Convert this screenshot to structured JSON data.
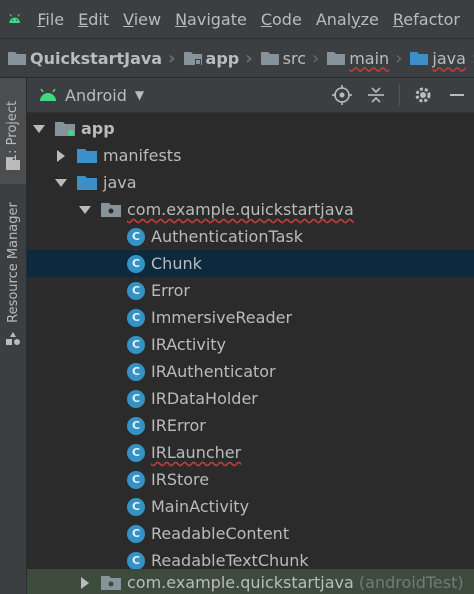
{
  "menubar": {
    "items": [
      {
        "label": "File",
        "underline": "F",
        "rest": "ile"
      },
      {
        "label": "Edit",
        "underline": "E",
        "rest": "dit"
      },
      {
        "label": "View",
        "underline": "V",
        "rest": "iew"
      },
      {
        "label": "Navigate",
        "underline": "N",
        "rest": "avigate"
      },
      {
        "label": "Code",
        "underline": "C",
        "rest": "ode"
      },
      {
        "label": "Analyze",
        "underline": "z",
        "rest": ""
      },
      {
        "label": "Refactor",
        "underline": "R",
        "rest": "efactor"
      }
    ]
  },
  "breadcrumb": {
    "project": "QuickstartJava",
    "module": "app",
    "src": "src",
    "main": "main",
    "java": "java"
  },
  "sidebar": {
    "project_tab": "1: Project",
    "resource_tab": "Resource Manager"
  },
  "toolbar": {
    "view_mode": "Android"
  },
  "tree": {
    "app": "app",
    "manifests": "manifests",
    "java": "java",
    "package": "com.example.quickstartjava",
    "classes": [
      "AuthenticationTask",
      "Chunk",
      "Error",
      "ImmersiveReader",
      "IRActivity",
      "IRAuthenticator",
      "IRDataHolder",
      "IRError",
      "IRLauncher",
      "IRStore",
      "MainActivity",
      "ReadableContent",
      "ReadableTextChunk"
    ],
    "test_package": "com.example.quickstartjava",
    "test_suffix": "(androidTest)",
    "class_icon_letter": "C"
  },
  "colors": {
    "selected_row": "#0d293e",
    "class_icon": "#3592c4",
    "folder": "#87939a",
    "java_folder": "#3d8fc9",
    "android_green": "#3ddc84"
  }
}
